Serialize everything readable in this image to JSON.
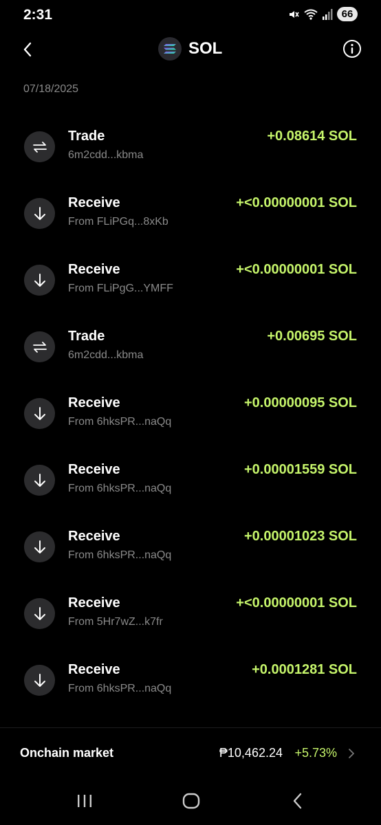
{
  "status_bar": {
    "time": "2:31",
    "battery": "66"
  },
  "header": {
    "title": "SOL"
  },
  "date": "07/18/2025",
  "transactions": [
    {
      "type": "Trade",
      "icon": "swap-icon",
      "subtitle": "6m2cdd...kbma",
      "amount": "+0.08614 SOL"
    },
    {
      "type": "Receive",
      "icon": "arrow-down-icon",
      "subtitle": "From FLiPGq...8xKb",
      "amount": "+<0.00000001 SOL"
    },
    {
      "type": "Receive",
      "icon": "arrow-down-icon",
      "subtitle": "From FLiPgG...YMFF",
      "amount": "+<0.00000001 SOL"
    },
    {
      "type": "Trade",
      "icon": "swap-icon",
      "subtitle": "6m2cdd...kbma",
      "amount": "+0.00695 SOL"
    },
    {
      "type": "Receive",
      "icon": "arrow-down-icon",
      "subtitle": "From 6hksPR...naQq",
      "amount": "+0.00000095 SOL"
    },
    {
      "type": "Receive",
      "icon": "arrow-down-icon",
      "subtitle": "From 6hksPR...naQq",
      "amount": "+0.00001559 SOL"
    },
    {
      "type": "Receive",
      "icon": "arrow-down-icon",
      "subtitle": "From 6hksPR...naQq",
      "amount": "+0.00001023 SOL"
    },
    {
      "type": "Receive",
      "icon": "arrow-down-icon",
      "subtitle": "From 5Hr7wZ...k7fr",
      "amount": "+<0.00000001 SOL"
    },
    {
      "type": "Receive",
      "icon": "arrow-down-icon",
      "subtitle": "From 6hksPR...naQq",
      "amount": "+0.0001281 SOL"
    }
  ],
  "market": {
    "label": "Onchain market",
    "price": "₱10,462.24",
    "change": "+5.73%"
  },
  "colors": {
    "background": "#000000",
    "positive": "#c6f56b",
    "secondary_text": "#8a8a8a",
    "icon_bg": "#2c2c2e"
  }
}
